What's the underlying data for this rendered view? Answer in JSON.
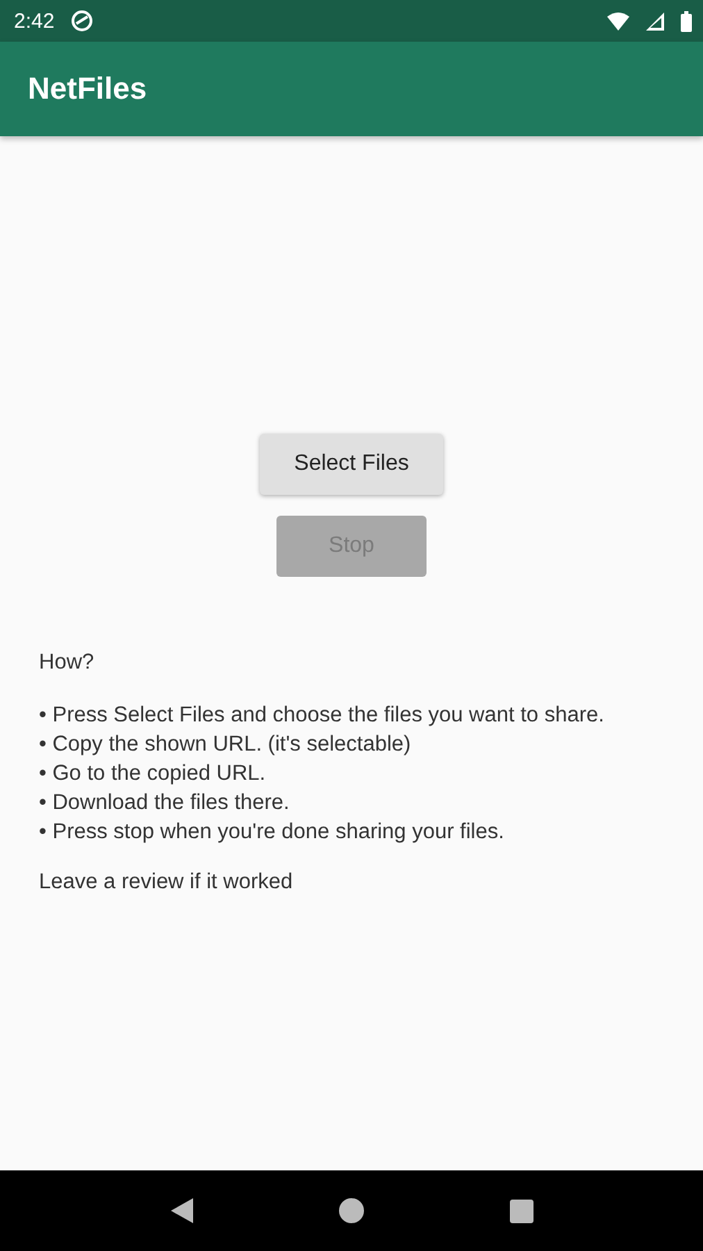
{
  "status_bar": {
    "time": "2:42"
  },
  "app_bar": {
    "title": "NetFiles"
  },
  "buttons": [
    {
      "label": "Select Files",
      "disabled": false
    },
    {
      "label": "Stop",
      "disabled": true
    }
  ],
  "instructions": {
    "heading": "How?",
    "steps": [
      "• Press Select Files and choose the files you want to share.",
      "• Copy the shown URL. (it's selectable)",
      "• Go to the copied URL.",
      "• Download the files there.",
      "• Press stop when you're done sharing your files."
    ],
    "footer": "Leave a review if it worked"
  }
}
